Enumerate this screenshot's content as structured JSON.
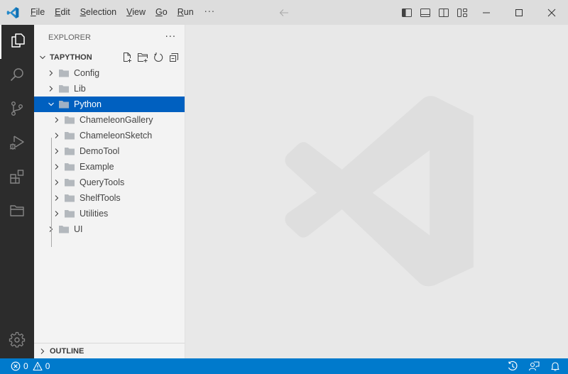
{
  "titlebar": {
    "app_icon": "vscode-logo-icon",
    "menu": [
      {
        "label": "File",
        "mnemonic": "F",
        "rest": "ile"
      },
      {
        "label": "Edit",
        "mnemonic": "E",
        "rest": "dit"
      },
      {
        "label": "Selection",
        "mnemonic": "S",
        "rest": "election"
      },
      {
        "label": "View",
        "mnemonic": "V",
        "rest": "iew"
      },
      {
        "label": "Go",
        "mnemonic": "G",
        "rest": "o"
      },
      {
        "label": "Run",
        "mnemonic": "R",
        "rest": "un"
      }
    ],
    "more_label": "···",
    "layout_controls": [
      "toggle-primary-sidebar-icon",
      "toggle-panel-icon",
      "toggle-secondary-sidebar-icon",
      "customize-layout-icon"
    ],
    "window_controls": [
      "minimize-icon",
      "maximize-icon",
      "close-icon"
    ]
  },
  "activitybar": {
    "items": [
      {
        "name": "explorer",
        "icon": "files-icon",
        "active": true
      },
      {
        "name": "search",
        "icon": "search-icon",
        "active": false
      },
      {
        "name": "source-control",
        "icon": "source-control-icon",
        "active": false
      },
      {
        "name": "run-debug",
        "icon": "run-debug-icon",
        "active": false
      },
      {
        "name": "extensions",
        "icon": "extensions-icon",
        "active": false
      },
      {
        "name": "remote-explorer",
        "icon": "folder-icon",
        "active": false
      }
    ],
    "bottom": [
      {
        "name": "manage",
        "icon": "gear-icon"
      }
    ]
  },
  "sidebar": {
    "title": "EXPLORER",
    "more_label": "···",
    "workspace": {
      "name": "TAPYTHON",
      "actions": [
        "new-file-icon",
        "new-folder-icon",
        "refresh-icon",
        "collapse-all-icon"
      ]
    },
    "tree": [
      {
        "label": "Config",
        "depth": 0,
        "expanded": false,
        "selected": false
      },
      {
        "label": "Lib",
        "depth": 0,
        "expanded": false,
        "selected": false
      },
      {
        "label": "Python",
        "depth": 0,
        "expanded": true,
        "selected": true
      },
      {
        "label": "ChameleonGallery",
        "depth": 1,
        "expanded": false,
        "selected": false
      },
      {
        "label": "ChameleonSketch",
        "depth": 1,
        "expanded": false,
        "selected": false
      },
      {
        "label": "DemoTool",
        "depth": 1,
        "expanded": false,
        "selected": false
      },
      {
        "label": "Example",
        "depth": 1,
        "expanded": false,
        "selected": false
      },
      {
        "label": "QueryTools",
        "depth": 1,
        "expanded": false,
        "selected": false
      },
      {
        "label": "ShelfTools",
        "depth": 1,
        "expanded": false,
        "selected": false
      },
      {
        "label": "Utilities",
        "depth": 1,
        "expanded": false,
        "selected": false
      },
      {
        "label": "UI",
        "depth": 0,
        "expanded": false,
        "selected": false
      }
    ],
    "outline_label": "OUTLINE"
  },
  "statusbar": {
    "errors": "0",
    "warnings": "0",
    "right_icons": [
      "history-icon",
      "accounts-feedback-icon",
      "bell-icon"
    ]
  },
  "colors": {
    "accent": "#007acc",
    "selection": "#0060c0",
    "activitybar": "#2c2c2c",
    "sidebar": "#f3f3f3",
    "editor": "#e8e8e8",
    "titlebar": "#dddddd"
  }
}
